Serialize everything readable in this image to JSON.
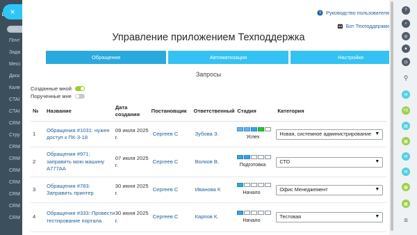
{
  "background_nav": {
    "items": [
      "Лен",
      "Почт",
      "Зада",
      "Месс",
      "Диск",
      "Кале",
      "CTAI",
      "CTAI",
      "CRM",
      "Стру",
      "CRM",
      "CRM",
      "CRM",
      "CRM",
      "CRM",
      "CRM",
      "CRM"
    ]
  },
  "close_button": {
    "label": "×"
  },
  "top_links": {
    "guide": "Руководство пользователя",
    "bot": "Бот Техподдержки"
  },
  "page_title": "Управление приложением Техподдержка",
  "tabs": [
    {
      "label": "Обращения",
      "active": true
    },
    {
      "label": "Автоматизация",
      "active": false
    },
    {
      "label": "Настройки",
      "active": false
    }
  ],
  "section_title": "Запросы",
  "filters": [
    {
      "label": "Созданные мной",
      "on": true
    },
    {
      "label": "Порученные мне",
      "on": false
    }
  ],
  "table": {
    "headers": [
      "№",
      "Название",
      "Дата создания",
      "Постановщик",
      "Ответственный",
      "Стадия",
      "Категория"
    ],
    "rows": [
      {
        "num": "1",
        "name": "Обращения #1031: нужен доступ к ПК-3-18",
        "date": "09 июля 2025 г.",
        "creator": "Сергеев С",
        "responsible": "Зубова З.",
        "stage": "Успех",
        "stage_segments": [
          "p",
          "p",
          "b",
          "g",
          ""
        ],
        "category": "Новая, системное администрирование"
      },
      {
        "num": "2",
        "name": "Обращения #971: заправить мою машину А777АА",
        "date": "07 июля 2025 г.",
        "creator": "Сергеев С",
        "responsible": "Волков В.",
        "stage": "Подготовка",
        "stage_segments": [
          "b",
          "b",
          "",
          "",
          ""
        ],
        "category": "СТО"
      },
      {
        "num": "3",
        "name": "Обращения #783: Заправить принтер",
        "date": "30 июня 2025 г.",
        "creator": "Сергеев С",
        "responsible": "Иванова К",
        "stage": "Начало",
        "stage_segments": [
          "b",
          "",
          "",
          "",
          ""
        ],
        "category": "Офис Менеджемент"
      },
      {
        "num": "4",
        "name": "Обращения #333: Провести тестирование портала",
        "date": "30 июня 2025 г.",
        "creator": "Сергеев С",
        "responsible": "Карпов К.",
        "stage": "Начало",
        "stage_segments": [
          "b",
          "",
          "",
          "",
          ""
        ],
        "category": "Тестовая"
      }
    ]
  },
  "right_rail": {
    "icons": [
      {
        "name": "help-icon",
        "text": "?"
      },
      {
        "name": "search-icon",
        "text": "⌕"
      },
      {
        "name": "goals-icon",
        "text": "◎"
      },
      {
        "name": "bell-icon",
        "text": "▲"
      },
      {
        "name": "stream-icon",
        "text": "◷"
      },
      {
        "name": "magnifier-icon",
        "text": "⚲"
      },
      {
        "name": "chat-icon",
        "text": "✉"
      },
      {
        "name": "avatar-rd",
        "text": "РД"
      },
      {
        "name": "chat-icon-2",
        "text": "▤"
      },
      {
        "name": "chat-icon-3",
        "text": "▦"
      },
      {
        "name": "chat-icon-4",
        "text": "✉"
      },
      {
        "name": "chat-icon-5",
        "text": "✉"
      },
      {
        "name": "chat-icon-6",
        "text": "▦"
      },
      {
        "name": "chat-icon-7",
        "text": "▦"
      },
      {
        "name": "chat-icon-8",
        "text": "▦"
      },
      {
        "name": "menu-icon",
        "text": "≡"
      }
    ]
  },
  "colors": {
    "accent": "#33c2f2",
    "link": "#1e5f9e",
    "toggle_on": "#9acd32"
  }
}
